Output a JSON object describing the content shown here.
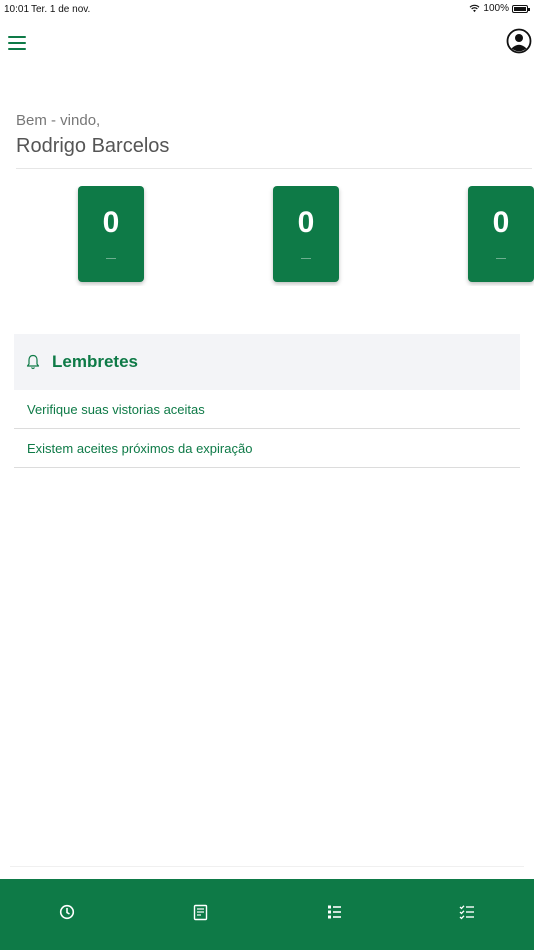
{
  "status_bar": {
    "time": "10:01",
    "date": "Ter. 1 de nov.",
    "battery": "100%",
    "battery_level": 1.0
  },
  "header": {
    "menu_icon": "hamburger-menu-icon",
    "profile_icon": "user-avatar-icon"
  },
  "welcome": {
    "greeting": "Bem - vindo,",
    "name": "Rodrigo Barcelos"
  },
  "cards": [
    {
      "value": "0"
    },
    {
      "value": "0"
    },
    {
      "value": "0"
    }
  ],
  "reminders": {
    "icon": "bell-icon",
    "title": "Lembretes",
    "items": [
      {
        "text": "Verifique suas vistorias aceitas"
      },
      {
        "text": "Existem aceites próximos da expiração"
      }
    ]
  },
  "tabs": [
    {
      "icon": "clock-icon"
    },
    {
      "icon": "document-icon"
    },
    {
      "icon": "list-icon"
    },
    {
      "icon": "checklist-icon"
    }
  ],
  "colors": {
    "primary": "#0e7a47",
    "header_bg": "#f3f4f7"
  }
}
